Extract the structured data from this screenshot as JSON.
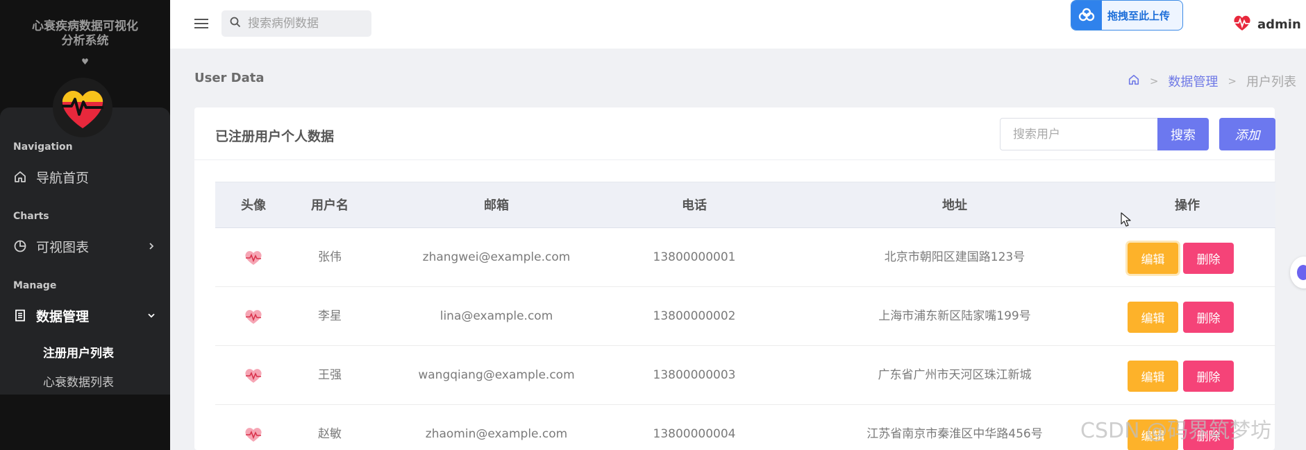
{
  "sidebar": {
    "brand_line1": "心衰疾病数据可视化",
    "brand_line2": "分析系统",
    "brand_heart": "♥",
    "sections": {
      "navigation": "Navigation",
      "charts": "Charts",
      "manage": "Manage"
    },
    "items": {
      "home": "导航首页",
      "charts": "可视图表",
      "data": "数据管理"
    },
    "subitems": {
      "users": "注册用户列表",
      "heart": "心衰数据列表"
    }
  },
  "topbar": {
    "search_placeholder": "搜索病例数据",
    "upload_label": "拖拽至此上传",
    "username": "admin"
  },
  "page": {
    "title": "User Data",
    "breadcrumb": [
      "数据管理",
      "用户列表"
    ]
  },
  "card": {
    "title": "已注册用户个人数据",
    "search_placeholder": "搜索用户",
    "search_button": "搜索",
    "add_button": "添加"
  },
  "table": {
    "headers": [
      "头像",
      "用户名",
      "邮箱",
      "电话",
      "地址",
      "操作"
    ],
    "edit_label": "编辑",
    "delete_label": "删除",
    "rows": [
      {
        "name": "张伟",
        "email": "zhangwei@example.com",
        "phone": "13800000001",
        "address": "北京市朝阳区建国路123号"
      },
      {
        "name": "李星",
        "email": "lina@example.com",
        "phone": "13800000002",
        "address": "上海市浦东新区陆家嘴199号"
      },
      {
        "name": "王强",
        "email": "wangqiang@example.com",
        "phone": "13800000003",
        "address": "广东省广州市天河区珠江新城"
      },
      {
        "name": "赵敏",
        "email": "zhaomin@example.com",
        "phone": "13800000004",
        "address": "江苏省南京市秦淮区中华路456号"
      }
    ]
  },
  "watermark": "CSDN @码界筑梦坊",
  "colors": {
    "accent": "#6c78ef",
    "edit": "#fdb22a",
    "delete": "#f54378",
    "sidebar": "#121212"
  }
}
